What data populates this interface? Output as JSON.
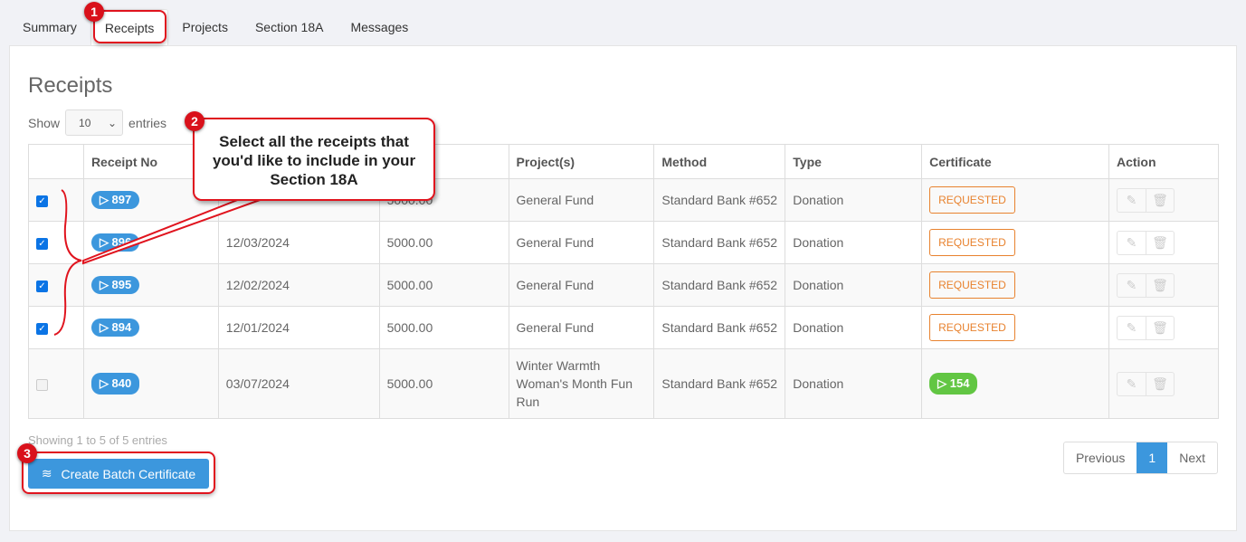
{
  "tabs": [
    {
      "label": "Summary"
    },
    {
      "label": "Receipts",
      "active": true
    },
    {
      "label": "Projects"
    },
    {
      "label": "Section 18A"
    },
    {
      "label": "Messages"
    }
  ],
  "page_title": "Receipts",
  "length": {
    "show": "Show",
    "value": "10",
    "entries": "entries"
  },
  "columns": [
    "",
    "Receipt No",
    "",
    "",
    "Project(s)",
    "Method",
    "Type",
    "Certificate",
    "Action"
  ],
  "rows": [
    {
      "checked": true,
      "receipt": "897",
      "date": "",
      "amount": "5000.00",
      "project": "General Fund",
      "method": "Standard Bank #652",
      "type": "Donation",
      "cert": "REQUESTED"
    },
    {
      "checked": true,
      "receipt": "896",
      "date": "12/03/2024",
      "amount": "5000.00",
      "project": "General Fund",
      "method": "Standard Bank #652",
      "type": "Donation",
      "cert": "REQUESTED"
    },
    {
      "checked": true,
      "receipt": "895",
      "date": "12/02/2024",
      "amount": "5000.00",
      "project": "General Fund",
      "method": "Standard Bank #652",
      "type": "Donation",
      "cert": "REQUESTED"
    },
    {
      "checked": true,
      "receipt": "894",
      "date": "12/01/2024",
      "amount": "5000.00",
      "project": "General Fund",
      "method": "Standard Bank #652",
      "type": "Donation",
      "cert": "REQUESTED"
    },
    {
      "checked": false,
      "receipt": "840",
      "date": "03/07/2024",
      "amount": "5000.00",
      "project": "Winter Warmth Woman's Month Fun Run",
      "method": "Standard Bank #652",
      "type": "Donation",
      "cert_badge": "154"
    }
  ],
  "info": "Showing 1 to 5 of 5 entries",
  "batch_button": "Create Batch Certificate",
  "pager": {
    "prev": "Previous",
    "page": "1",
    "next": "Next"
  },
  "annotations": {
    "b1": "1",
    "b2": "2",
    "b3": "3",
    "callout": "Select all the receipts that you'd like to include in your Section 18A"
  },
  "colors": {
    "accent": "#3c97dd",
    "requested": "#e8822e",
    "issued": "#62c643",
    "annotation": "#e0141e"
  }
}
